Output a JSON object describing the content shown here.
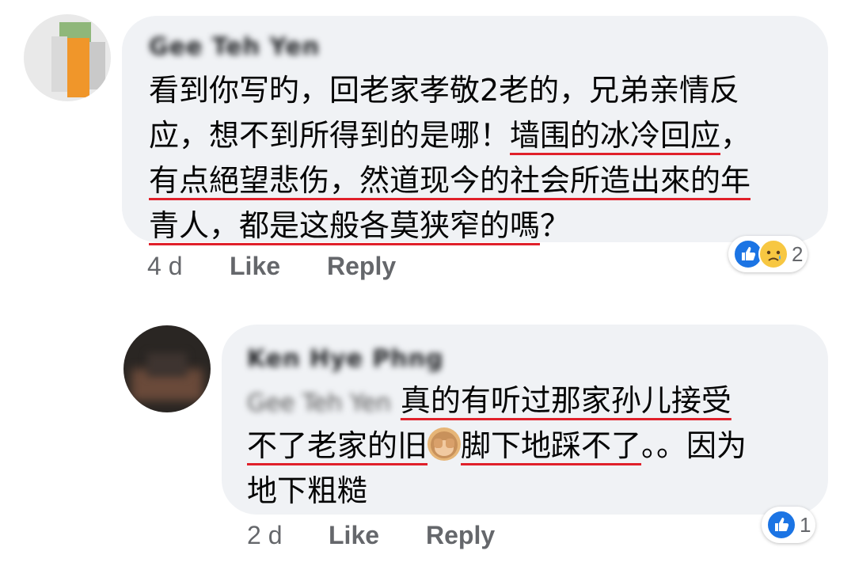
{
  "comment1": {
    "author": "Gee Teh Yen",
    "lines": [
      {
        "plain": "看到你写旳，回老家孝敬2老的，兄弟亲情反"
      },
      {
        "plain": "应，想不到所得到的是哪！",
        "underlined": "墙围的冰冷回应",
        "after": "，"
      },
      {
        "underlined": "有点絕望悲伤，然道现今的社会所造出來的年"
      },
      {
        "underlined": "青人，都是这般各莫狭窄的嗎",
        "after": "？"
      }
    ],
    "time": "4 d",
    "like_label": "Like",
    "reply_label": "Reply",
    "reaction_count": "2",
    "reactions": [
      "like-icon",
      "sad-icon"
    ]
  },
  "comment2": {
    "author": "Ken Hye Phng",
    "tag": "Gee Teh Yen",
    "line1_underlined": "真的有听过那家孙儿接受",
    "line2_underlined_a": "不了老家的旧",
    "line2_underlined_b": "脚下地踩不了",
    "line2_after": "。。因为",
    "line3": "地下粗糙",
    "time": "2 d",
    "like_label": "Like",
    "reply_label": "Reply",
    "reaction_count": "1",
    "reactions": [
      "like-icon"
    ]
  },
  "colors": {
    "underline": "#e0202a",
    "bubble": "#f0f2f5",
    "like": "#1b74e4",
    "meta": "#65676b"
  }
}
